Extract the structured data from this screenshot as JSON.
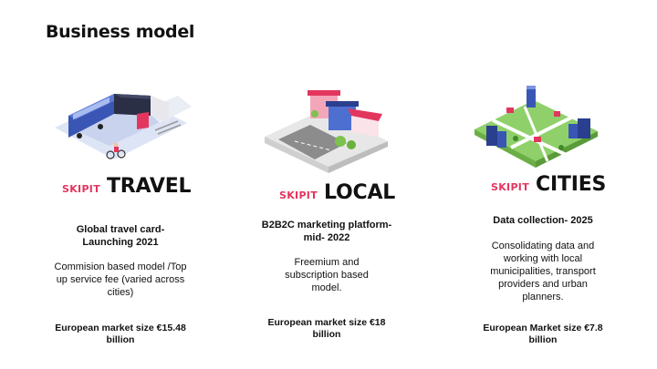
{
  "page": {
    "title": "Business model"
  },
  "brand_prefix": "SKIPIT",
  "columns": [
    {
      "name": "TRAVEL",
      "heading": "Global travel card-\nLaunching 2021",
      "description": "Commision based model /Top up service fee (varied across cities)",
      "market": "European market size €15.48 billion"
    },
    {
      "name": "LOCAL",
      "heading": "B2B2C marketing platform-\nmid- 2022",
      "description": "Freemium and subscription based model.",
      "market": "European market size €18 billion"
    },
    {
      "name": "CITIES",
      "heading": "Data collection- 2025",
      "description": "Consolidating data and working with  local municipalities, transport providers and urban planners.",
      "market": "European Market size €7.8 billion"
    }
  ]
}
